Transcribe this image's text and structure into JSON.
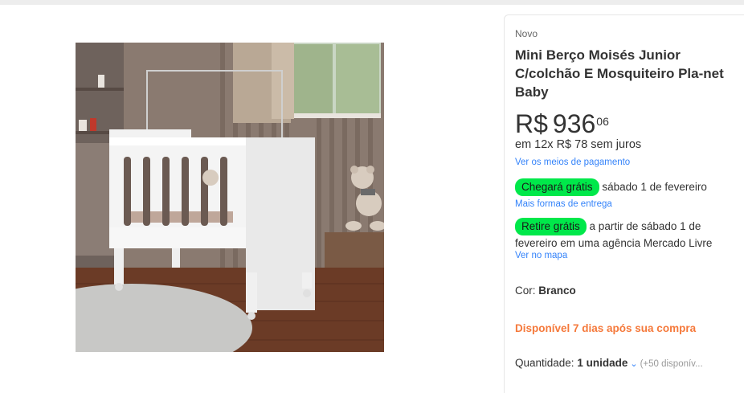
{
  "product": {
    "condition": "Novo",
    "title": "Mini Berço Moisés Junior C/colchão E Mosquiteiro Pla-net Baby",
    "price_currency": "R$",
    "price_int": "936",
    "price_cents": "06",
    "installments": "em 12x R$ 78 sem juros",
    "payment_link": "Ver os meios de pagamento"
  },
  "shipping": {
    "delivery_badge": "Chegará grátis",
    "delivery_date": "sábado 1 de fevereiro",
    "delivery_link": "Mais formas de entrega",
    "pickup_badge": "Retire grátis",
    "pickup_text": "a partir de sábado 1 de fevereiro em uma agência Mercado Livre",
    "pickup_link": "Ver no mapa"
  },
  "color": {
    "label": "Cor:",
    "value": "Branco"
  },
  "availability": "Disponível 7 dias após sua compra",
  "quantity": {
    "label": "Quantidade:",
    "value": "1 unidade",
    "stock": "(+50 disponív..."
  },
  "colors": {
    "accent_link": "#3483fa",
    "badge_green": "#00e84a",
    "availability_orange": "#f5793b"
  }
}
